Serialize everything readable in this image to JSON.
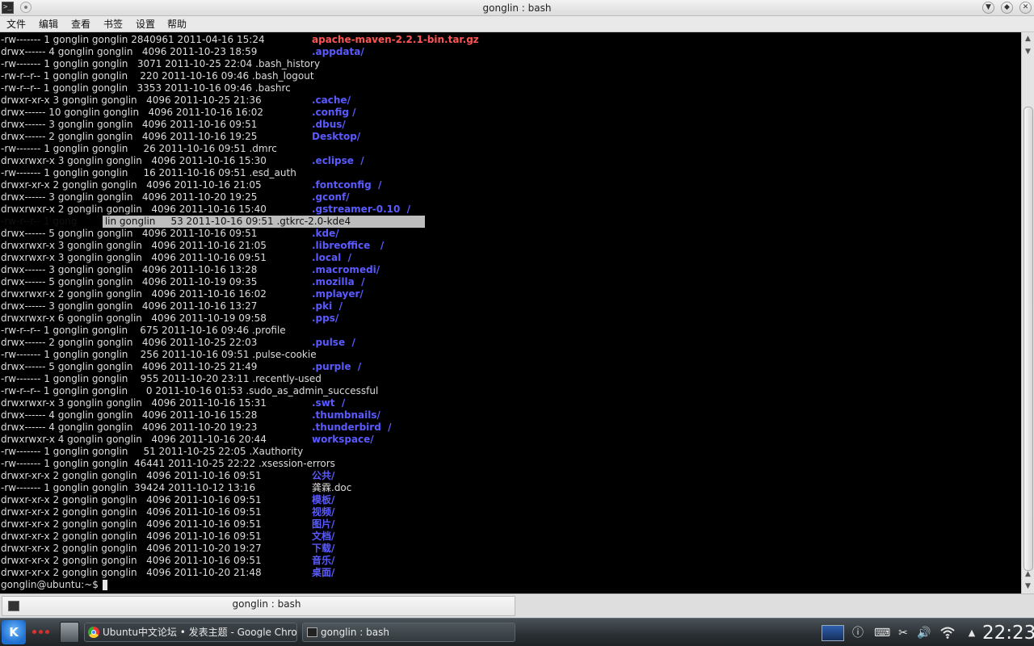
{
  "window": {
    "title": "gonglin : bash",
    "app_icon": "terminal-icon",
    "buttons": [
      "chevron-down-icon",
      "diamond-icon",
      "close-icon"
    ]
  },
  "menu": {
    "items": [
      "文件",
      "编辑",
      "查看",
      "书签",
      "设置",
      "帮助"
    ]
  },
  "terminal": {
    "rows": [
      {
        "meta": "-rw------- 1 gonglin gonglin 2840961 2011-04-16 15:24",
        "name": "apache-maven-2.2.1-bin.tar.gz",
        "type": "archive"
      },
      {
        "meta": "drwx------ 4 gonglin gonglin   4096 2011-10-23 18:59",
        "name": ".appdata/",
        "type": "dir"
      },
      {
        "meta": "-rw------- 1 gonglin gonglin   3071 2011-10-25 22:04 .bash_history",
        "name": "",
        "type": "plain"
      },
      {
        "meta": "-rw-r--r-- 1 gonglin gonglin    220 2011-10-16 09:46 .bash_logout",
        "name": "",
        "type": "plain"
      },
      {
        "meta": "-rw-r--r-- 1 gonglin gonglin   3353 2011-10-16 09:46 .bashrc",
        "name": "",
        "type": "plain"
      },
      {
        "meta": "drwxr-xr-x 3 gonglin gonglin   4096 2011-10-25 21:36",
        "name": ".cache/",
        "type": "dir"
      },
      {
        "meta": "drwx------ 10 gonglin gonglin   4096 2011-10-16 16:02",
        "name": ".config /",
        "type": "dir"
      },
      {
        "meta": "drwx------ 3 gonglin gonglin   4096 2011-10-16 09:51",
        "name": ".dbus/",
        "type": "dir"
      },
      {
        "meta": "drwx------ 2 gonglin gonglin   4096 2011-10-16 19:25",
        "name": "Desktop/",
        "type": "dir"
      },
      {
        "meta": "-rw------- 1 gonglin gonglin     26 2011-10-16 09:51 .dmrc",
        "name": "",
        "type": "plain"
      },
      {
        "meta": "drwxrwxr-x 3 gonglin gonglin   4096 2011-10-16 15:30",
        "name": ".eclipse  /",
        "type": "dir"
      },
      {
        "meta": "-rw------- 1 gonglin gonglin     16 2011-10-16 09:51 .esd_auth",
        "name": "",
        "type": "plain"
      },
      {
        "meta": "drwxr-xr-x 2 gonglin gonglin   4096 2011-10-16 21:05",
        "name": ".fontconfig  /",
        "type": "dir"
      },
      {
        "meta": "drwx------ 3 gonglin gonglin   4096 2011-10-20 19:25",
        "name": ".gconf/",
        "type": "dir"
      },
      {
        "meta": "drwxrwxr-x 2 gonglin gonglin   4096 2011-10-16 15:40",
        "name": ".gstreamer-0.10  /",
        "type": "dir"
      },
      {
        "meta": "-rw-r--r-- 1 gong         lin gonglin     53 2011-10-16 09:51 .gtkrc-2.0-kde4",
        "name": "",
        "type": "plain",
        "selected": true
      },
      {
        "meta": "drwx------ 5 gonglin gonglin   4096 2011-10-16 09:51",
        "name": ".kde/",
        "type": "dir"
      },
      {
        "meta": "drwxrwxr-x 3 gonglin gonglin   4096 2011-10-16 21:05",
        "name": ".libreoffice   /",
        "type": "dir"
      },
      {
        "meta": "drwxrwxr-x 3 gonglin gonglin   4096 2011-10-16 09:51",
        "name": ".local  /",
        "type": "dir"
      },
      {
        "meta": "drwx------ 3 gonglin gonglin   4096 2011-10-16 13:28",
        "name": ".macromedi/",
        "type": "dir"
      },
      {
        "meta": "drwx------ 5 gonglin gonglin   4096 2011-10-19 09:35",
        "name": ".mozilla  /",
        "type": "dir"
      },
      {
        "meta": "drwxrwxr-x 2 gonglin gonglin   4096 2011-10-16 16:02",
        "name": ".mplayer/",
        "type": "dir"
      },
      {
        "meta": "drwx------ 3 gonglin gonglin   4096 2011-10-16 13:27",
        "name": ".pki  /",
        "type": "dir"
      },
      {
        "meta": "drwxrwxr-x 6 gonglin gonglin   4096 2011-10-19 09:58",
        "name": ".pps/",
        "type": "dir"
      },
      {
        "meta": "-rw-r--r-- 1 gonglin gonglin    675 2011-10-16 09:46 .profile",
        "name": "",
        "type": "plain"
      },
      {
        "meta": "drwx------ 2 gonglin gonglin   4096 2011-10-25 22:03",
        "name": ".pulse  /",
        "type": "dir"
      },
      {
        "meta": "-rw------- 1 gonglin gonglin    256 2011-10-16 09:51 .pulse-cookie",
        "name": "",
        "type": "plain"
      },
      {
        "meta": "drwx------ 5 gonglin gonglin   4096 2011-10-25 21:49",
        "name": ".purple  /",
        "type": "dir"
      },
      {
        "meta": "-rw------- 1 gonglin gonglin    955 2011-10-20 23:11 .recently-used",
        "name": "",
        "type": "plain"
      },
      {
        "meta": "-rw-r--r-- 1 gonglin gonglin      0 2011-10-16 01:53 .sudo_as_admin_successful",
        "name": "",
        "type": "plain"
      },
      {
        "meta": "drwxrwxr-x 3 gonglin gonglin   4096 2011-10-16 15:31",
        "name": ".swt  /",
        "type": "dir"
      },
      {
        "meta": "drwx------ 4 gonglin gonglin   4096 2011-10-16 15:28",
        "name": ".thumbnails/",
        "type": "dir"
      },
      {
        "meta": "drwx------ 4 gonglin gonglin   4096 2011-10-20 19:23",
        "name": ".thunderbird  /",
        "type": "dir"
      },
      {
        "meta": "drwxrwxr-x 4 gonglin gonglin   4096 2011-10-16 20:44",
        "name": "workspace/",
        "type": "dir"
      },
      {
        "meta": "-rw------- 1 gonglin gonglin     51 2011-10-25 22:05 .Xauthority",
        "name": "",
        "type": "plain"
      },
      {
        "meta": "-rw------- 1 gonglin gonglin  46441 2011-10-25 22:22 .xsession-errors",
        "name": "",
        "type": "plain"
      },
      {
        "meta": "drwxr-xr-x 2 gonglin gonglin   4096 2011-10-16 09:51",
        "name": "公共/",
        "type": "dir"
      },
      {
        "meta": "-rw------- 1 gonglin gonglin  39424 2011-10-12 13:16",
        "name": "龚霖.doc",
        "type": "file"
      },
      {
        "meta": "drwxr-xr-x 2 gonglin gonglin   4096 2011-10-16 09:51",
        "name": "模板/",
        "type": "dir"
      },
      {
        "meta": "drwxr-xr-x 2 gonglin gonglin   4096 2011-10-16 09:51",
        "name": "视频/",
        "type": "dir"
      },
      {
        "meta": "drwxr-xr-x 2 gonglin gonglin   4096 2011-10-16 09:51",
        "name": "图片/",
        "type": "dir"
      },
      {
        "meta": "drwxr-xr-x 2 gonglin gonglin   4096 2011-10-16 09:51",
        "name": "文档/",
        "type": "dir"
      },
      {
        "meta": "drwxr-xr-x 2 gonglin gonglin   4096 2011-10-20 19:27",
        "name": "下载/",
        "type": "dir"
      },
      {
        "meta": "drwxr-xr-x 2 gonglin gonglin   4096 2011-10-16 09:51",
        "name": "音乐/",
        "type": "dir"
      },
      {
        "meta": "drwxr-xr-x 2 gonglin gonglin   4096 2011-10-20 21:48",
        "name": "桌面/",
        "type": "dir"
      }
    ],
    "prompt": "gonglin@ubuntu:~$",
    "colors": {
      "dir": "#5a5aff",
      "archive": "#ff5454",
      "text": "#dcdcdc",
      "selection": "#bdbdbd"
    }
  },
  "tabs": [
    {
      "label": "gonglin : bash",
      "icon": "terminal-icon",
      "active": true
    }
  ],
  "taskbar": {
    "tasks": [
      {
        "label": "Ubuntu中文论坛 • 发表主题 - Google Chrome",
        "icon": "chrome-icon",
        "active": false
      },
      {
        "label": "gonglin : bash",
        "icon": "terminal-icon",
        "active": true
      }
    ],
    "tray_icons": [
      "desktop-pager-icon",
      "info-icon",
      "keyboard-icon",
      "clipboard-scissors-icon",
      "volume-icon",
      "wifi-icon",
      "tray-expand-icon"
    ],
    "clock": "22:23"
  }
}
